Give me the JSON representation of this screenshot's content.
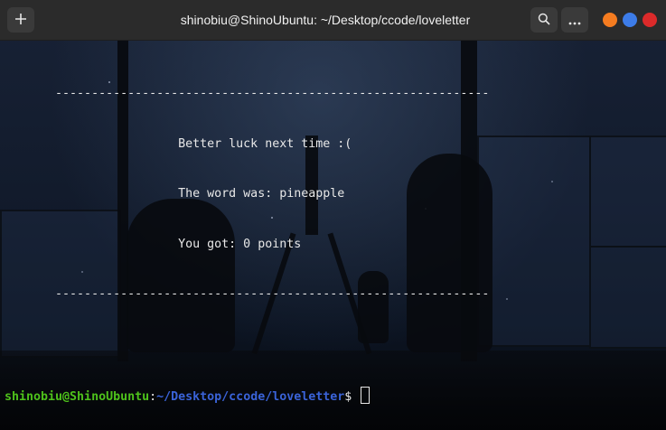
{
  "window": {
    "title": "shinobiu@ShinoUbuntu: ~/Desktop/ccode/loveletter",
    "buttons": {
      "new_tab_icon": "plus-icon",
      "search_icon": "search-icon",
      "menu_icon": "menu-icon"
    },
    "controls": {
      "minimize_color": "#f57c20",
      "maximize_color": "#3d7ce8",
      "close_color": "#dc2a2a"
    }
  },
  "terminal": {
    "lines": [
      "       ------------------------------------------------------------",
      "                        Better luck next time :(",
      "                        The word was: pineapple",
      "                        You got: 0 points",
      "       ------------------------------------------------------------",
      ""
    ],
    "prompt": {
      "user_host": "shinobiu@ShinoUbuntu",
      "separator": ":",
      "path": "~/Desktop/ccode/loveletter",
      "symbol": "$ "
    }
  }
}
